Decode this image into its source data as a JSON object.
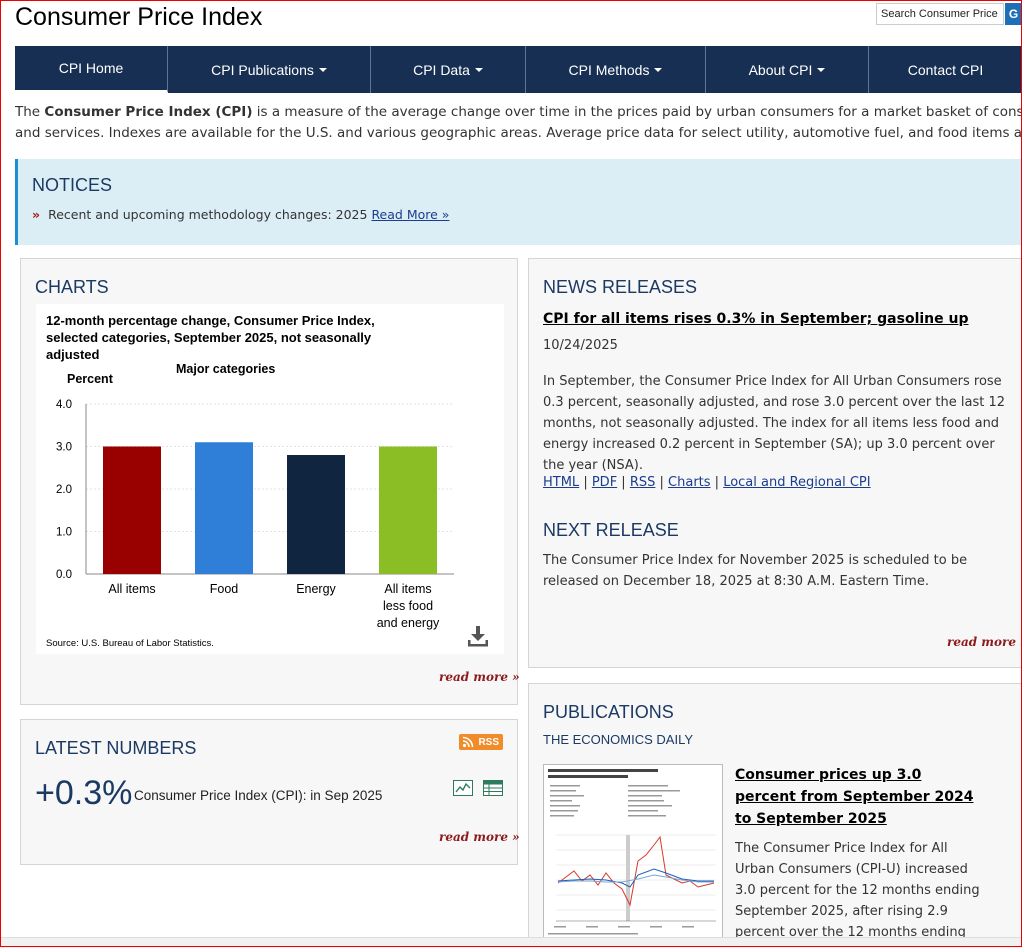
{
  "header": {
    "title": "Consumer Price Index",
    "search_placeholder": "Search Consumer Price",
    "search_button": "G"
  },
  "nav": {
    "items": [
      {
        "label": "CPI Home",
        "dropdown": false
      },
      {
        "label": "CPI Publications",
        "dropdown": true
      },
      {
        "label": "CPI Data",
        "dropdown": true
      },
      {
        "label": "CPI Methods",
        "dropdown": true
      },
      {
        "label": "About CPI",
        "dropdown": true
      },
      {
        "label": "Contact CPI",
        "dropdown": false
      }
    ]
  },
  "intro": {
    "prefix": "The ",
    "bold": "Consumer Price Index (CPI)",
    "line1_rest": " is a measure of the average change over time in the prices paid by urban consumers for a market basket of consumer goods",
    "line2": "and services. Indexes are available for the U.S. and various geographic areas. Average price data for select utility, automotive fuel, and food items are also available."
  },
  "notices": {
    "title": "NOTICES",
    "item_text": "Recent and upcoming methodology changes: 2025 ",
    "item_link": "Read More »"
  },
  "charts": {
    "title": "CHARTS",
    "read_more": "read more »",
    "source": "Source: U.S. Bureau of Labor Statistics."
  },
  "chart_data": {
    "type": "bar",
    "title": "12-month percentage change, Consumer Price Index, selected categories, September 2025, not seasonally adjusted",
    "subtitle": "Major categories",
    "ylabel": "Percent",
    "xlabel": "",
    "categories": [
      "All items",
      "Food",
      "Energy",
      "All items less food and energy"
    ],
    "category_lines": [
      [
        "All items"
      ],
      [
        "Food"
      ],
      [
        "Energy"
      ],
      [
        "All items",
        "less food",
        "and energy"
      ]
    ],
    "values": [
      3.0,
      3.1,
      2.8,
      3.0
    ],
    "colors": [
      "#990000",
      "#2f7fd9",
      "#0f2540",
      "#8bbd24"
    ],
    "ylim": [
      0,
      4.0
    ],
    "yticks": [
      "0.0",
      "1.0",
      "2.0",
      "3.0",
      "4.0"
    ],
    "grid": true
  },
  "news": {
    "title": "NEWS RELEASES",
    "headline": "CPI for all items rises 0.3% in September; gasoline up",
    "date": "10/24/2025",
    "body": "In September, the Consumer Price Index for All Urban Consumers rose 0.3 percent, seasonally adjusted, and rose 3.0 percent over the last 12 months, not seasonally adjusted. The index for all items less food and energy increased 0.2 percent in September (SA); up 3.0 percent over the year (NSA).",
    "links": [
      "HTML",
      "PDF",
      "RSS",
      "Charts",
      "Local and Regional CPI"
    ],
    "next_title": "NEXT RELEASE",
    "next_body": "The Consumer Price Index for November 2025 is scheduled to be released on December 18, 2025 at 8:30 A.M. Eastern Time.",
    "read_more": "read more »"
  },
  "latest": {
    "title": "LATEST NUMBERS",
    "rss_label": "RSS",
    "value": "+0.3%",
    "label": "Consumer Price Index (CPI): in Sep 2025",
    "read_more": "read more »"
  },
  "publications": {
    "title": "PUBLICATIONS",
    "subtitle": "THE ECONOMICS DAILY",
    "headline": "Consumer prices up 3.0 percent from September 2024 to September 2025",
    "body": "The Consumer Price Index for All Urban Consumers (CPI-U) increased 3.0 percent for the 12 months ending September 2025, after rising 2.9 percent over the 12 months ending"
  }
}
